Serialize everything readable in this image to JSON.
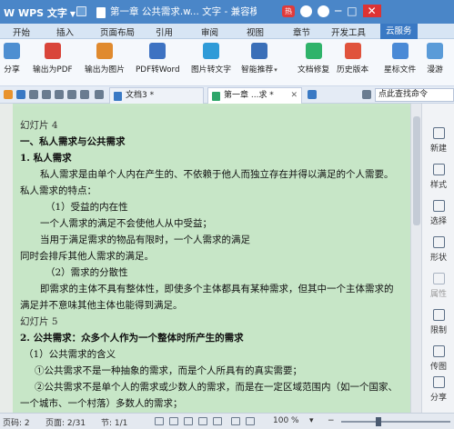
{
  "titlebar": {
    "app_name": "W WPS 文字",
    "doc_title": "第一章 公共需求.w... 文字 - 兼容模式",
    "hot_badge": "热",
    "colors": {
      "bar": "#4a86c8",
      "close": "#dd3333"
    }
  },
  "ribbon_tabs": [
    "开始",
    "插入",
    "页面布局",
    "引用",
    "审阅",
    "视图",
    "章节",
    "开发工具",
    "云服务"
  ],
  "active_ribbon_tab": "云服务",
  "toolbar": [
    {
      "label": "分享",
      "icon": "share-icon"
    },
    {
      "label": "输出为PDF",
      "icon": "pdf-export-icon"
    },
    {
      "label": "输出为图片",
      "icon": "image-export-icon"
    },
    {
      "label": "PDF转Word",
      "icon": "pdf-to-word-icon"
    },
    {
      "label": "图片转文字",
      "icon": "ocr-icon"
    },
    {
      "label": "智能推荐",
      "icon": "recommend-icon"
    },
    {
      "label": "文档修复",
      "icon": "repair-icon"
    },
    {
      "label": "历史版本",
      "icon": "history-icon"
    },
    {
      "label": "星标文件",
      "icon": "star-file-icon"
    },
    {
      "label": "漫游",
      "icon": "roaming-icon"
    }
  ],
  "doc_tabs": [
    {
      "label": "文档3 *",
      "active": false
    },
    {
      "label": "第一章 ...求 *",
      "active": true
    }
  ],
  "search_placeholder": "点此查找命令",
  "document_lines": [
    {
      "text": "幻灯片 4",
      "style": "slide",
      "indent": 8
    },
    {
      "text": "一、私人需求与公共需求",
      "style": "bold",
      "indent": 8
    },
    {
      "text": "1. 私人需求",
      "style": "bold",
      "indent": 8
    },
    {
      "text": "私人需求是由单个人内在产生的、不依赖于他人而独立存在并得以满足的个人需要。",
      "style": "normal",
      "indent": 30
    },
    {
      "text": "私人需求的特点：",
      "style": "normal",
      "indent": 8
    },
    {
      "text": "（1）受益的内在性",
      "style": "normal",
      "indent": 36
    },
    {
      "text": "一个人需求的满足不会使他人从中受益；",
      "style": "normal",
      "indent": 30
    },
    {
      "text": "当用于满足需求的物品有限时，一个人需求的满足",
      "style": "normal",
      "indent": 30
    },
    {
      "text": "同时会排斥其他人需求的满足。",
      "style": "normal",
      "indent": 8
    },
    {
      "text": "（2）需求的分散性",
      "style": "normal",
      "indent": 36
    },
    {
      "text": "即需求的主体不具有整体性，即使多个主体都具有某种需求，但其中一个主体需求的",
      "style": "normal",
      "indent": 30
    },
    {
      "text": "满足并不意味其他主体也能得到满足。",
      "style": "normal",
      "indent": 8
    },
    {
      "text": "幻灯片 5",
      "style": "slide",
      "indent": 8
    },
    {
      "text": "2. 公共需求：众多个人作为一个整体时所产生的需求",
      "style": "bold",
      "indent": 8
    },
    {
      "text": "（1）公共需求的含义",
      "style": "normal",
      "indent": 12
    },
    {
      "text": "①公共需求不是一种抽象的需求，而是个人所具有的真实需要；",
      "style": "normal",
      "indent": 24
    },
    {
      "text": "②公共需求不是单个人的需求或少数人的需求，而是在一定区域范围内（如一个国家、",
      "style": "normal",
      "indent": 24
    },
    {
      "text": "一个城市、一个村落）多数人的需求；",
      "style": "normal",
      "indent": 8
    }
  ],
  "right_panel": [
    {
      "label": "新建",
      "icon": "new-icon",
      "enabled": true
    },
    {
      "label": "样式",
      "icon": "style-icon",
      "enabled": true
    },
    {
      "label": "选择",
      "icon": "select-icon",
      "enabled": true
    },
    {
      "label": "形状",
      "icon": "shape-icon",
      "enabled": true
    },
    {
      "label": "属性",
      "icon": "properties-icon",
      "enabled": false
    },
    {
      "label": "限制",
      "icon": "restrict-icon",
      "enabled": true
    },
    {
      "label": "传图",
      "icon": "upload-image-icon",
      "enabled": true
    },
    {
      "label": "分享",
      "icon": "share-icon",
      "enabled": true
    }
  ],
  "statusbar": {
    "page_no": "页码: 2",
    "page": "页面: 2/31",
    "section": "节: 1/1",
    "zoom": "100 %",
    "zoom_level": 0.33
  },
  "colors": {
    "page_bg": "#c7e6c7",
    "accent": "#3a79c4"
  }
}
